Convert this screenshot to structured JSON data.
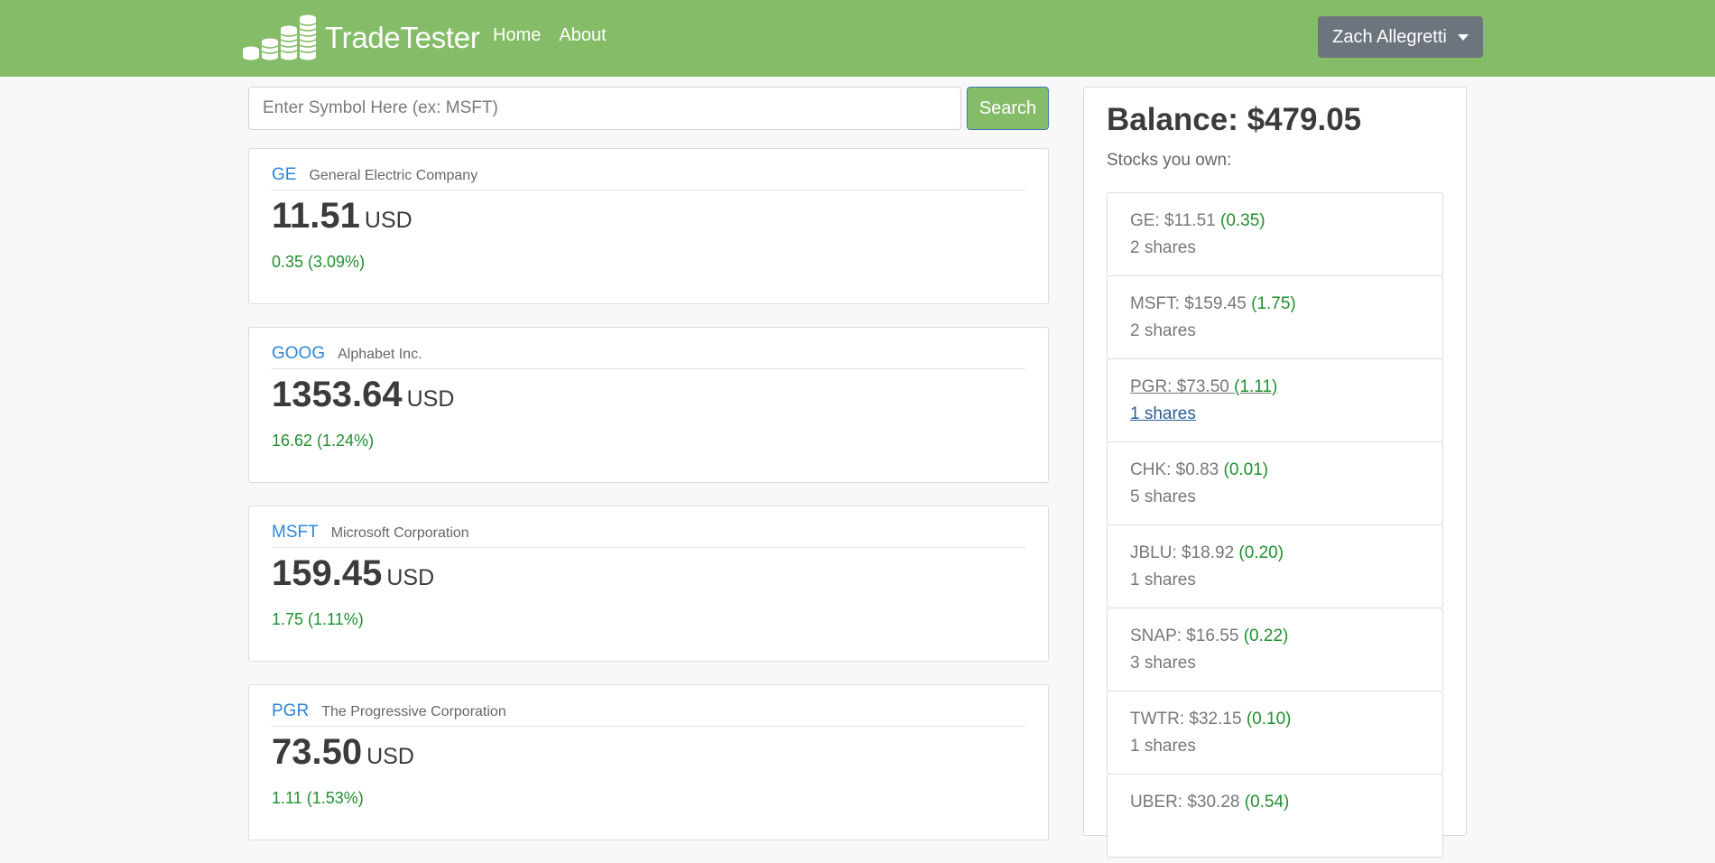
{
  "nav": {
    "brand": "TradeTester",
    "links": [
      "Home",
      "About"
    ],
    "user": "Zach Allegretti"
  },
  "search": {
    "placeholder": "Enter Symbol Here (ex: MSFT)",
    "button": "Search"
  },
  "stocks": [
    {
      "symbol": "GE",
      "name": "General Electric Company",
      "price": "11.51",
      "currency": "USD",
      "change": "0.35 (3.09%)"
    },
    {
      "symbol": "GOOG",
      "name": "Alphabet Inc.",
      "price": "1353.64",
      "currency": "USD",
      "change": "16.62 (1.24%)"
    },
    {
      "symbol": "MSFT",
      "name": "Microsoft Corporation",
      "price": "159.45",
      "currency": "USD",
      "change": "1.75 (1.11%)"
    },
    {
      "symbol": "PGR",
      "name": "The Progressive Corporation",
      "price": "73.50",
      "currency": "USD",
      "change": "1.11 (1.53%)"
    }
  ],
  "portfolio": {
    "balance": "Balance: $479.05",
    "label": "Stocks you own:",
    "holdings": [
      {
        "label": "GE: $11.51 ",
        "change": "(0.35)",
        "shares": "2 shares"
      },
      {
        "label": "MSFT: $159.45 ",
        "change": "(1.75)",
        "shares": "2 shares"
      },
      {
        "label": "PGR: $73.50 ",
        "change": "(1.11)",
        "shares": "1 shares"
      },
      {
        "label": "CHK: $0.83 ",
        "change": "(0.01)",
        "shares": "5 shares"
      },
      {
        "label": "JBLU: $18.92 ",
        "change": "(0.20)",
        "shares": "1 shares"
      },
      {
        "label": "SNAP: $16.55 ",
        "change": "(0.22)",
        "shares": "3 shares"
      },
      {
        "label": "TWTR: $32.15 ",
        "change": "(0.10)",
        "shares": "1 shares"
      },
      {
        "label": "UBER: $30.28 ",
        "change": "(0.54)",
        "shares": ""
      }
    ]
  },
  "colors": {
    "navbar": "#85bc68",
    "accent_link": "#2d86d9",
    "positive": "#1f8f2f",
    "user_button": "#6c757d"
  },
  "icons": {
    "brand_logo": "coin-stacks-icon",
    "user_caret": "caret-down-icon"
  }
}
